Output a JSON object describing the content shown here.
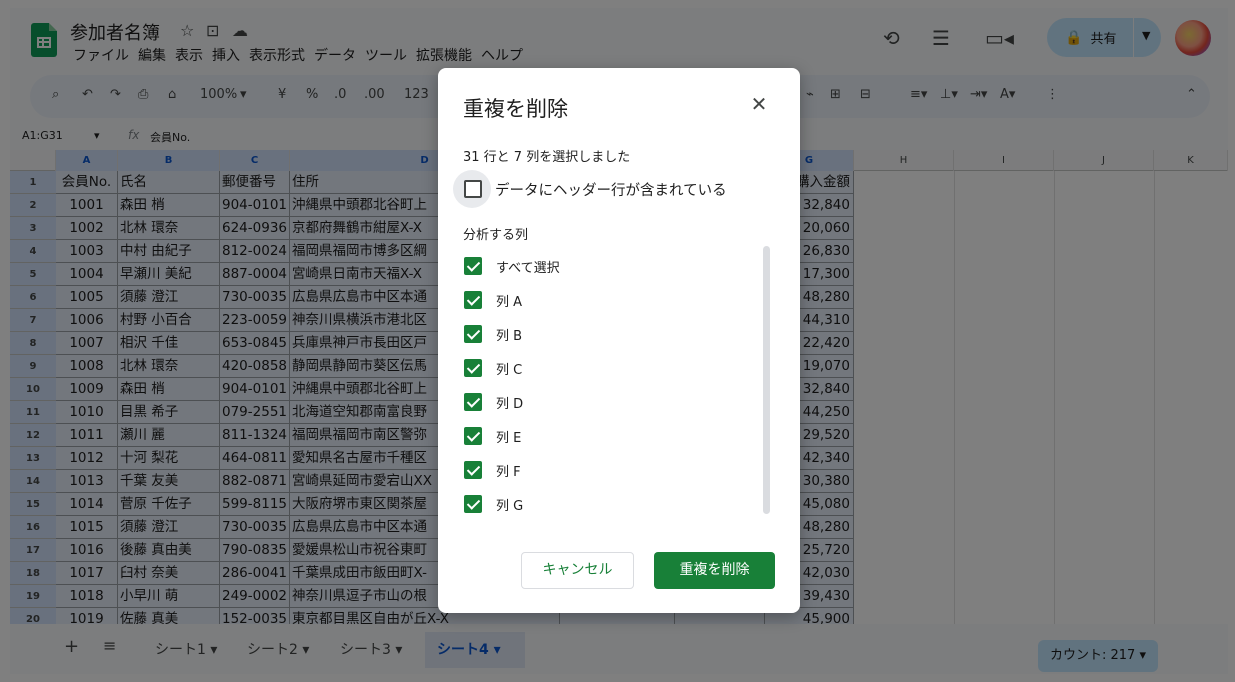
{
  "header": {
    "title": "参加者名簿",
    "menu": [
      "ファイル",
      "編集",
      "表示",
      "挿入",
      "表示形式",
      "データ",
      "ツール",
      "拡張機能",
      "ヘルプ"
    ],
    "share_label": "共有"
  },
  "toolbar": {
    "zoom": "100%",
    "currency": "¥",
    "percent": "%",
    "dec_decrease": ".0",
    "dec_increase": ".00",
    "number_format": "123"
  },
  "formula_bar": {
    "cell_ref": "A1:G31",
    "content": "会員No."
  },
  "grid": {
    "col_headers": [
      "A",
      "B",
      "C",
      "D",
      "G",
      "H",
      "I",
      "J",
      "K"
    ],
    "row_numbers": [
      "1",
      "2",
      "3",
      "4",
      "5",
      "6",
      "7",
      "8",
      "9",
      "10",
      "11",
      "12",
      "13",
      "14",
      "15",
      "16",
      "17",
      "18",
      "19",
      "20"
    ],
    "header_row": {
      "a": "会員No.",
      "b": "氏名",
      "c": "郵便番号",
      "d": "住所",
      "g": "購入金額"
    },
    "rows": [
      {
        "a": "1001",
        "b": "森田 梢",
        "c": "904-0101",
        "d": "沖縄県中頭郡北谷町上",
        "g": "32,840"
      },
      {
        "a": "1002",
        "b": "北林 環奈",
        "c": "624-0936",
        "d": "京都府舞鶴市紺屋X-X",
        "g": "20,060"
      },
      {
        "a": "1003",
        "b": "中村 由紀子",
        "c": "812-0024",
        "d": "福岡県福岡市博多区綱",
        "g": "26,830"
      },
      {
        "a": "1004",
        "b": "早瀬川 美紀",
        "c": "887-0004",
        "d": "宮崎県日南市天福X-X",
        "g": "17,300"
      },
      {
        "a": "1005",
        "b": "須藤 澄江",
        "c": "730-0035",
        "d": "広島県広島市中区本通",
        "g": "48,280"
      },
      {
        "a": "1006",
        "b": "村野 小百合",
        "c": "223-0059",
        "d": "神奈川県横浜市港北区",
        "g": "44,310"
      },
      {
        "a": "1007",
        "b": "相沢 千佳",
        "c": "653-0845",
        "d": "兵庫県神戸市長田区戸",
        "g": "22,420"
      },
      {
        "a": "1008",
        "b": "北林 環奈",
        "c": "420-0858",
        "d": "静岡県静岡市葵区伝馬",
        "g": "19,070"
      },
      {
        "a": "1009",
        "b": "森田 梢",
        "c": "904-0101",
        "d": "沖縄県中頭郡北谷町上",
        "g": "32,840"
      },
      {
        "a": "1010",
        "b": "目黒 希子",
        "c": "079-2551",
        "d": "北海道空知郡南富良野",
        "g": "44,250"
      },
      {
        "a": "1011",
        "b": "瀬川 麗",
        "c": "811-1324",
        "d": "福岡県福岡市南区警弥",
        "g": "29,520"
      },
      {
        "a": "1012",
        "b": "十河 梨花",
        "c": "464-0811",
        "d": "愛知県名古屋市千種区",
        "g": "42,340"
      },
      {
        "a": "1013",
        "b": "千葉 友美",
        "c": "882-0871",
        "d": "宮崎県延岡市愛宕山XX",
        "g": "30,380"
      },
      {
        "a": "1014",
        "b": "菅原 千佐子",
        "c": "599-8115",
        "d": "大阪府堺市東区関茶屋",
        "g": "45,080"
      },
      {
        "a": "1015",
        "b": "須藤 澄江",
        "c": "730-0035",
        "d": "広島県広島市中区本通",
        "g": "48,280"
      },
      {
        "a": "1016",
        "b": "後藤 真由美",
        "c": "790-0835",
        "d": "愛媛県松山市祝谷東町",
        "g": "25,720"
      },
      {
        "a": "1017",
        "b": "臼村 奈美",
        "c": "286-0041",
        "d": "千葉県成田市飯田町X-",
        "g": "42,030"
      },
      {
        "a": "1018",
        "b": "小早川 萌",
        "c": "249-0002",
        "d": "神奈川県逗子市山の根",
        "g": "39,430"
      },
      {
        "a": "1019",
        "b": "佐藤 真美",
        "c": "152-0035",
        "d": "東京都目黒区自由が丘X-X",
        "g": "45,900"
      }
    ]
  },
  "sheets": {
    "tabs": [
      "シート1",
      "シート2",
      "シート3",
      "シート4"
    ],
    "active": "シート4",
    "count": "カウント: 217"
  },
  "dialog": {
    "title": "重複を削除",
    "selection_info": "31 行と 7 列を選択しました",
    "header_checkbox_label": "データにヘッダー行が含まれている",
    "header_checkbox_checked": false,
    "section_label": "分析する列",
    "columns": [
      {
        "label": "すべて選択",
        "checked": true
      },
      {
        "label": "列 A",
        "checked": true
      },
      {
        "label": "列 B",
        "checked": true
      },
      {
        "label": "列 C",
        "checked": true
      },
      {
        "label": "列 D",
        "checked": true
      },
      {
        "label": "列 E",
        "checked": true
      },
      {
        "label": "列 F",
        "checked": true
      },
      {
        "label": "列 G",
        "checked": true
      }
    ],
    "cancel_label": "キャンセル",
    "confirm_label": "重複を削除"
  },
  "colors": {
    "accent_green": "#188038",
    "share_blue": "#c2e7ff",
    "selection_blue": "#d3e3fd"
  }
}
